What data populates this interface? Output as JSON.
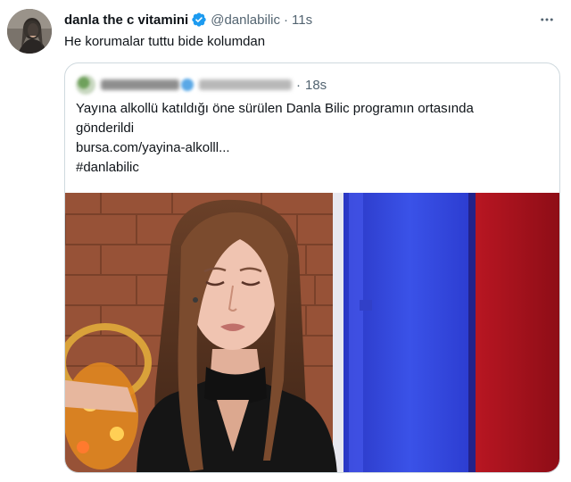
{
  "tweet": {
    "display_name": "danla the c vitamini",
    "handle": "@danlabilic",
    "separator": "·",
    "time": "11s",
    "text": "He korumalar tuttu bide kolumdan",
    "avatar_icon": "profile-photo",
    "verified_icon": "verified-badge-icon",
    "more_icon": "more-options-icon"
  },
  "quoted": {
    "author_name_blurred": true,
    "separator": "·",
    "time": "18s",
    "text_line_1": "Yayına alkollü katıldığı öne sürülen Danla Bilic programın ortasında",
    "text_line_2": "gönderildi",
    "link": "bursa.com/yayina-alkolll...",
    "hashtag": "#danlabilic",
    "media": {
      "description_icon": "tv-show-photo"
    }
  },
  "colors": {
    "text_primary": "#0f1419",
    "text_secondary": "#536471",
    "border": "#cfd9de",
    "verified": "#1d9bf0"
  }
}
